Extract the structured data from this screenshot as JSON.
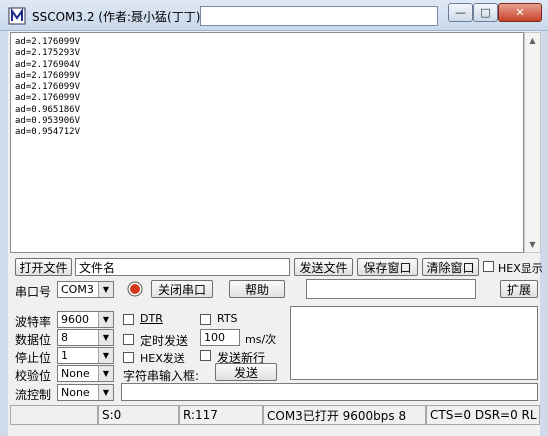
{
  "window": {
    "title": "SSCOM3.2 (作者:聂小猛(丁丁),",
    "title_input": "",
    "minimize": "—",
    "maximize": "□",
    "close": "✕"
  },
  "receive": {
    "lines": [
      "ad=2.176099V",
      "ad=2.175293V",
      "ad=2.176904V",
      "ad=2.176099V",
      "ad=2.176099V",
      "ad=2.176099V",
      "ad=0.965186V",
      "ad=0.953906V",
      "ad=0.954712V"
    ]
  },
  "file_row": {
    "open_file": "打开文件",
    "file_name": "文件名",
    "send_file": "发送文件",
    "save_window": "保存窗口",
    "clear_window": "清除窗口",
    "hex_display": "HEX显示"
  },
  "port_row": {
    "port_label": "串口号",
    "port_value": "COM3",
    "close_port": "关闭串口",
    "help": "帮助",
    "expand": "扩展"
  },
  "settings": {
    "baud_label": "波特率",
    "baud_value": "9600",
    "data_label": "数据位",
    "data_value": "8",
    "stop_label": "停止位",
    "stop_value": "1",
    "parity_label": "校验位",
    "parity_value": "None",
    "flow_label": "流控制",
    "flow_value": "None"
  },
  "send_options": {
    "dtr": "DTR",
    "rts": "RTS",
    "timed_send": "定时发送",
    "interval_value": "100",
    "interval_unit": "ms/次",
    "hex_send": "HEX发送",
    "send_newline": "发送新行",
    "input_label": "字符串输入框:",
    "send_button": "发送"
  },
  "status": {
    "s_count": "S:0",
    "r_count": "R:117",
    "port_status": "COM3已打开  9600bps  8",
    "lines_status": "CTS=0 DSR=0 RL"
  },
  "colors": {
    "accent_red": "#d43a1a",
    "title_bar": "#dfe9f5"
  }
}
